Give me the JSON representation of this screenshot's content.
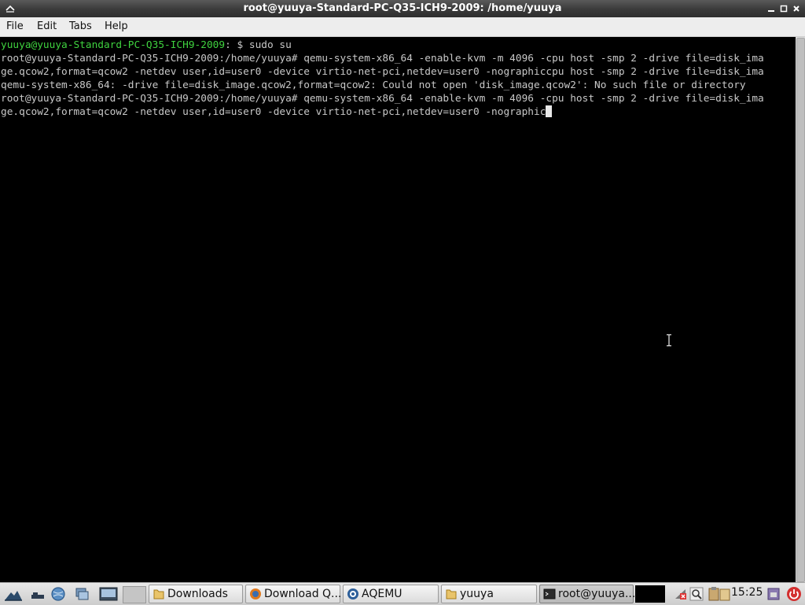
{
  "window": {
    "title": "root@yuuya-Standard-PC-Q35-ICH9-2009: /home/yuuya",
    "controls": [
      "minimize-icon",
      "maximize-icon",
      "close-icon"
    ]
  },
  "menu": [
    "File",
    "Edit",
    "Tabs",
    "Help"
  ],
  "terminal": {
    "lines": [
      {
        "prompt_user": "yuuya@yuuya-Standard-PC-Q35-ICH9-2009",
        "prompt_rest": ": $ sudo su"
      },
      {
        "text": "root@yuuya-Standard-PC-Q35-ICH9-2009:/home/yuuya# qemu-system-x86_64 -enable-kvm -m 4096 -cpu host -smp 2 -drive file=disk_ima"
      },
      {
        "text": "ge.qcow2,format=qcow2 -netdev user,id=user0 -device virtio-net-pci,netdev=user0 -nographiccpu host -smp 2 -drive file=disk_ima"
      },
      {
        "text": "qemu-system-x86_64: -drive file=disk_image.qcow2,format=qcow2: Could not open 'disk_image.qcow2': No such file or directory"
      },
      {
        "text": "root@yuuya-Standard-PC-Q35-ICH9-2009:/home/yuuya# qemu-system-x86_64 -enable-kvm -m 4096 -cpu host -smp 2 -drive file=disk_ima"
      },
      {
        "text": "ge.qcow2,format=qcow2 -netdev user,id=user0 -device virtio-net-pci,netdev=user0 -nographic"
      }
    ],
    "colors": {
      "fg": "#c8c8c8",
      "prompt": "#3fd23f",
      "bg": "#000000"
    }
  },
  "taskbar": {
    "launchers": [
      "start-menu-icon",
      "show-desktop-icon",
      "file-manager-icon",
      "browser-icon",
      "workspace-icon",
      "terminal-icon",
      "workspace-pager-icon"
    ],
    "tasks": [
      {
        "label": "Downloads",
        "icon": "folder-icon"
      },
      {
        "label": "Download Q...",
        "icon": "firefox-icon"
      },
      {
        "label": "AQEMU",
        "icon": "aqemu-icon"
      },
      {
        "label": "yuuya",
        "icon": "folder-icon"
      },
      {
        "label": "root@yuuya...",
        "icon": "terminal-icon"
      }
    ],
    "tray": [
      "cpu-monitor-icon",
      "network-off-icon",
      "search-icon",
      "clipboard-icon",
      "files-icon"
    ],
    "clock": "15:25",
    "end_icons": [
      "lock-screen-icon",
      "power-icon"
    ]
  }
}
